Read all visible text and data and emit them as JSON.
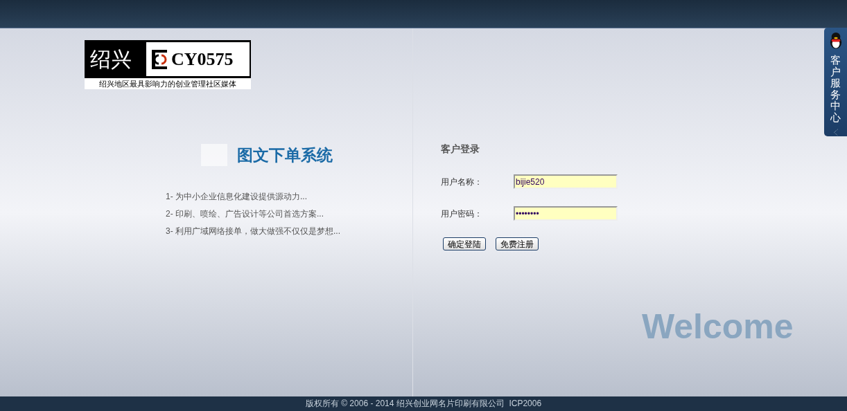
{
  "logo": {
    "city": "绍兴",
    "brand": "CY0575",
    "slogan": "绍兴地区最具影响力的创业管理社区媒体"
  },
  "system_title": "图文下单系统",
  "features": [
    "1- 为中小企业信息化建设提供源动力...",
    "2- 印刷、喷绘、广告设计等公司首选方案...",
    "3- 利用广域网络接单，做大做强不仅仅是梦想..."
  ],
  "login": {
    "title": "客户登录",
    "fields": [
      {
        "label": "用户名称：",
        "value": "bijie520"
      },
      {
        "label": "用户密码：",
        "value": "••••••••"
      }
    ],
    "buttons": [
      "确定登陆",
      "免费注册"
    ]
  },
  "welcome": "Welcome",
  "side_tab": {
    "label": "客户服务中心"
  },
  "footer": "版权所有 © 2006 - 2014 绍兴创业网名片印刷有限公司  ICP2006"
}
